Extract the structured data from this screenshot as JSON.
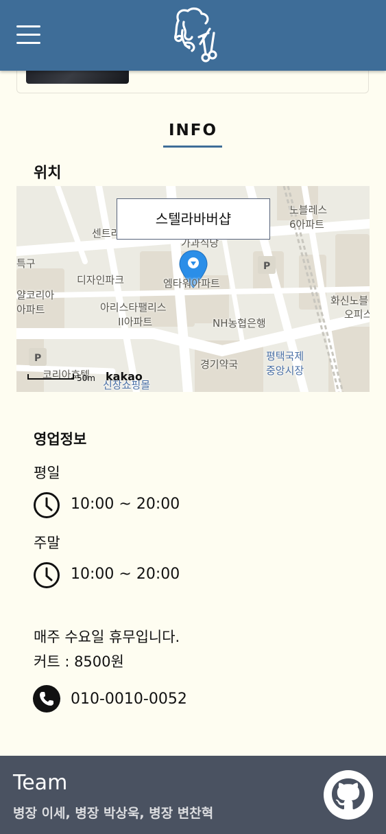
{
  "header": {
    "menu_icon": "hamburger-menu-icon",
    "logo_icon": "barber-scissors-logo"
  },
  "info": {
    "title": "INFO",
    "location_label": "위치"
  },
  "map": {
    "shop_name": "스텔라바버샵",
    "scale": "50m",
    "provider": "kakao",
    "labels": [
      "센트라",
      "노블레스",
      "6아파트",
      "가과식당",
      "특구",
      "디자인파크",
      "엠타워아파트",
      "얄코리아",
      "아파트",
      "아리스타팰리스",
      "II아파트",
      "NH농협은행",
      "화신노블",
      "오피스",
      "코리아호텔",
      "경기약국",
      "평택국제",
      "중앙시장",
      "신장쇼핑몰"
    ]
  },
  "business": {
    "label": "영업정보",
    "weekday_label": "평일",
    "weekday_hours": "10:00 ~ 20:00",
    "weekend_label": "주말",
    "weekend_hours": "10:00 ~ 20:00",
    "closed_note": "매주 수요일 휴무입니다.",
    "cut_price": "커트 : 8500원",
    "phone": "010-0010-0052"
  },
  "footer": {
    "title": "Team",
    "members": "병장 이세, 병장 박상욱, 병장 변찬혁",
    "github_icon": "github-icon"
  },
  "colors": {
    "header_bg": "#3e6d98",
    "page_bg": "#fefdf1",
    "footer_bg": "#4a5261",
    "marker": "#2b8ee8"
  }
}
